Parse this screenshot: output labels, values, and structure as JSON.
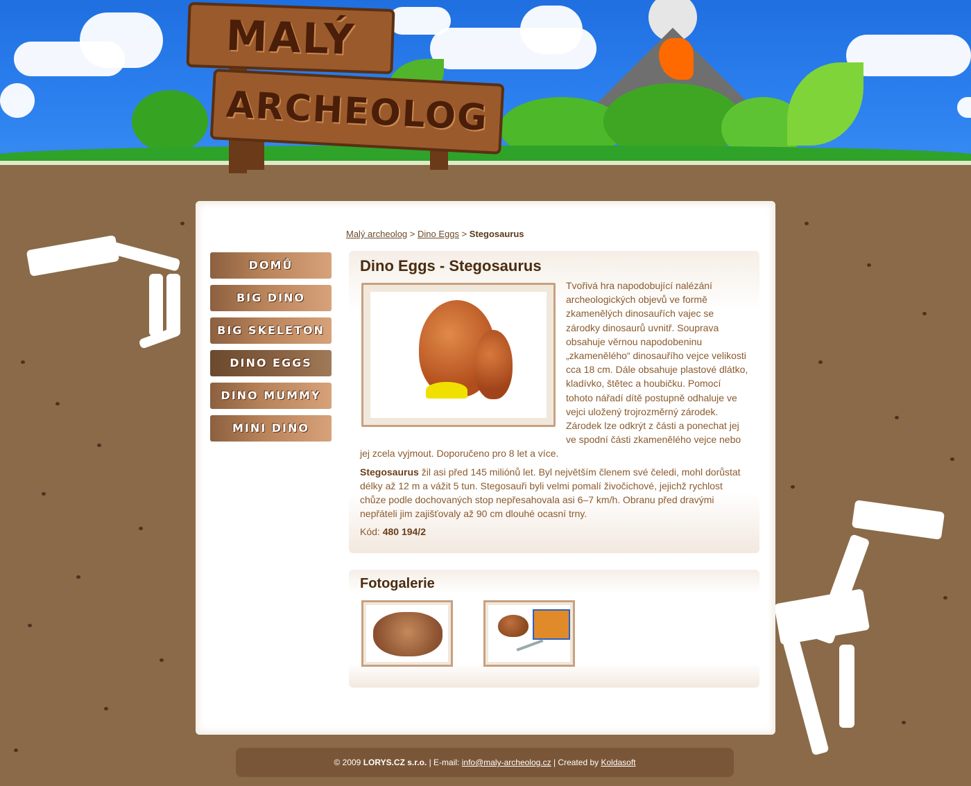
{
  "logo": {
    "line1": "MALÝ",
    "line2": "ARCHEOLOG"
  },
  "breadcrumb": {
    "item1": "Malý archeolog",
    "sep1": " > ",
    "item2": "Dino Eggs",
    "sep2": " > ",
    "current": "Stegosaurus"
  },
  "menu": {
    "items": [
      {
        "label": "DOMŮ"
      },
      {
        "label": "BIG DINO"
      },
      {
        "label": "BIG SKELETON"
      },
      {
        "label": "DINO EGGS"
      },
      {
        "label": "DINO MUMMY"
      },
      {
        "label": "MINI DINO"
      }
    ]
  },
  "product": {
    "title": "Dino Eggs - Stegosaurus",
    "description": "Tvořivá hra napodobující nalézání archeologických objevů ve formě zkamenělých dinosauřích vajec se zárodky dinosaurů uvnitř. Souprava obsahuje věrnou napodobeninu „zkamenělého“ dinosauřího vejce velikosti cca 18 cm. Dále obsahuje plastové dlátko, kladívko, štětec a houbičku. Pomocí tohoto nářadí dítě postupně odhaluje ve vejci uložený trojrozměrný zárodek. Zárodek lze odkrýt z části a ponechat jej ve spodní části zkamenělého vejce nebo jej zcela vyjmout. Doporučeno pro 8 let a více.",
    "dino_name": "Stegosaurus",
    "dino_text": " žil asi před 145 miliónů let. Byl největším členem své čeledi, mohl dorůstat délky až 12 m a vážit 5 tun. Stegosauři byli velmi pomalí živočichové, jejichž rychlost chůze podle dochovaných stop nepřesahovala asi 6–7 km/h. Obranu před dravými nepřáteli jim zajišťovaly až 90 cm dlouhé ocasní trny.",
    "code_label": "Kód: ",
    "code_value": "480 194/2"
  },
  "gallery": {
    "title": "Fotogalerie"
  },
  "footer": {
    "copyright": "© 2009 ",
    "company": "LORYS.CZ s.r.o.",
    "email_label": " | E-mail: ",
    "email": "info@maly-archeolog.cz",
    "created_label": " | Created by ",
    "creator": "Koldasoft"
  },
  "colors": {
    "sky": "#2e82f0",
    "ground": "#8a6a48",
    "paper": "#ffffff",
    "text": "#8a5a2e",
    "heading": "#4a2c10",
    "footer": "#7a5638"
  }
}
